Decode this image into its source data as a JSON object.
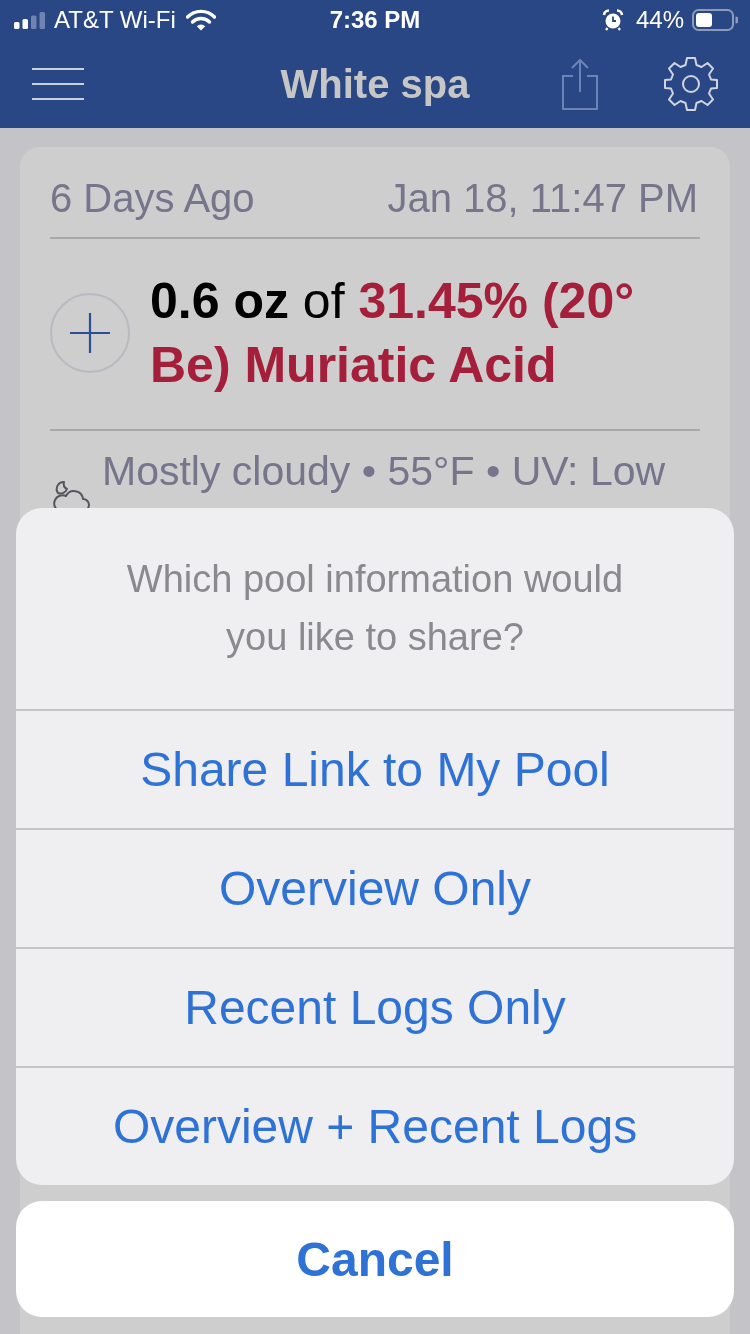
{
  "status_bar": {
    "carrier": "AT&T Wi-Fi",
    "time": "7:36 PM",
    "battery": "44%"
  },
  "nav_bar": {
    "title": "White spa"
  },
  "log_card": {
    "age": "6 Days Ago",
    "timestamp": "Jan 18, 11:47 PM",
    "entries": [
      {
        "amount": "0.6 oz",
        "connector": "of",
        "chemical": "31.45% (20° Be) Muriatic Acid",
        "color": "#a51f3b"
      }
    ],
    "weather": "Mostly cloudy • 55°F • UV: Low"
  },
  "share_sheet": {
    "title": "Which pool information would you like to share?",
    "options": [
      "Share Link to My Pool",
      "Overview Only",
      "Recent Logs Only",
      "Overview + Recent Logs"
    ],
    "cancel": "Cancel"
  }
}
